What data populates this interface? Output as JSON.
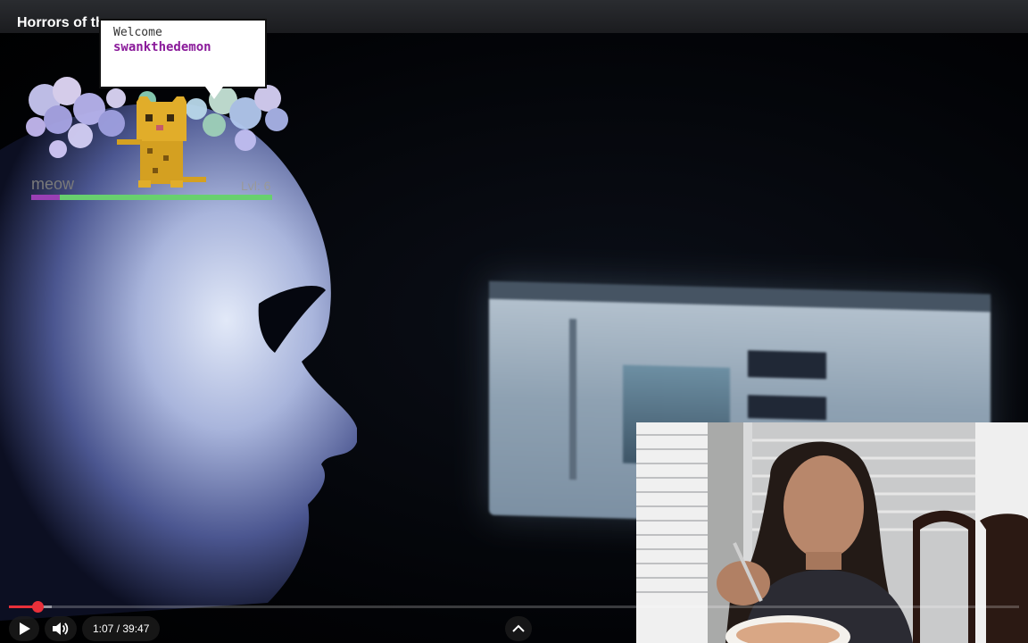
{
  "video": {
    "title": "Horrors of th",
    "time_display": "1:07 / 39:47",
    "progress_fraction": 0.0281,
    "buffered_fraction": 0.0428
  },
  "widget": {
    "welcome_label": "Welcome",
    "username": "swankthedemon",
    "meow_label": "meow",
    "level_label": "Lvl: 6",
    "xp_fraction": 0.12
  },
  "colors": {
    "accent_red": "#e9303a",
    "xp_green": "#68d06e",
    "xp_purple": "#9a3fb4",
    "username_purple": "#8a1a9a"
  },
  "icons": {
    "play": "play-icon",
    "volume": "volume-icon",
    "chevron": "chevron-up-icon"
  }
}
